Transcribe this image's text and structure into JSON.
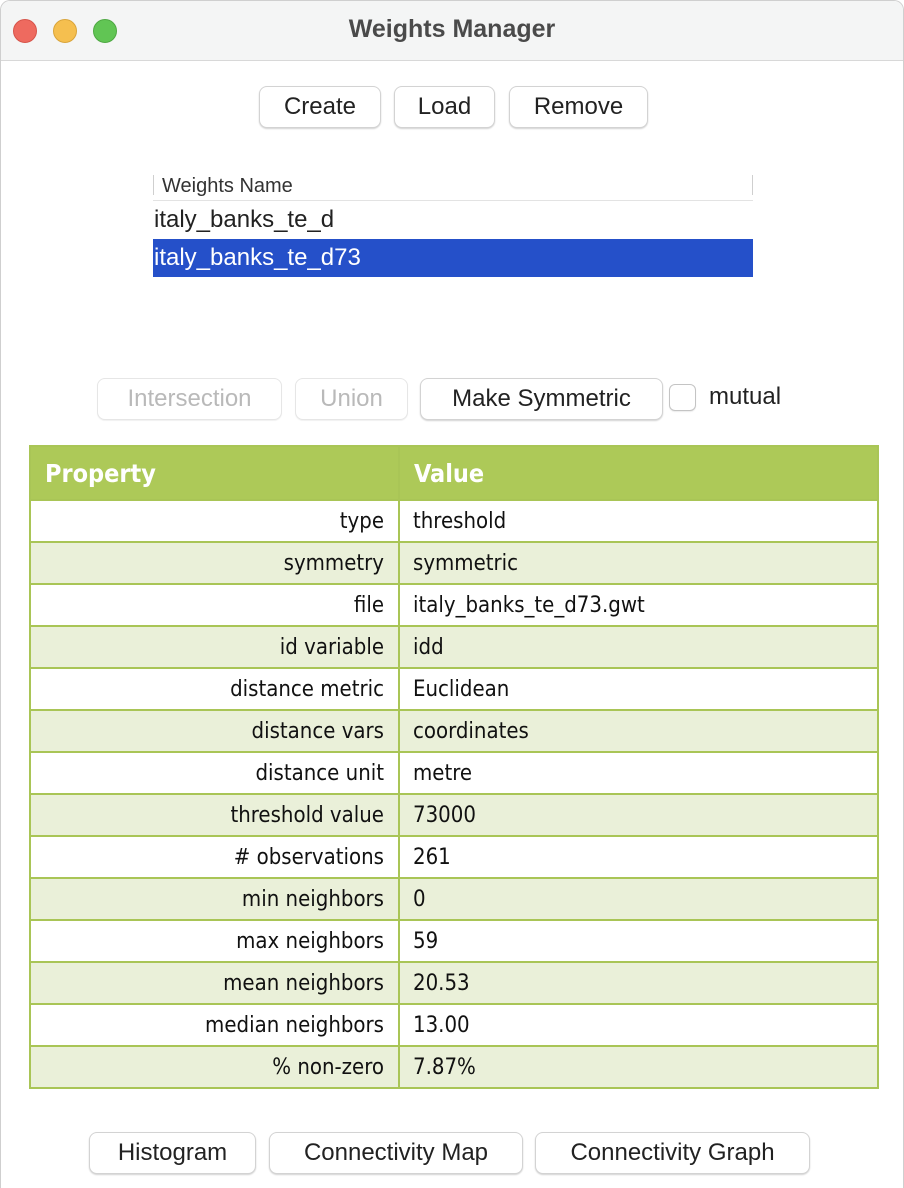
{
  "window": {
    "title": "Weights Manager"
  },
  "toolbar": {
    "create_label": "Create",
    "load_label": "Load",
    "remove_label": "Remove"
  },
  "weights_list": {
    "header": "Weights Name",
    "items": [
      {
        "name": "italy_banks_te_d",
        "selected": false
      },
      {
        "name": "italy_banks_te_d73",
        "selected": true
      }
    ]
  },
  "operations": {
    "intersection_label": "Intersection",
    "intersection_enabled": false,
    "union_label": "Union",
    "union_enabled": false,
    "make_symmetric_label": "Make Symmetric",
    "make_symmetric_enabled": true,
    "mutual_label": "mutual",
    "mutual_checked": false
  },
  "properties": {
    "header_property": "Property",
    "header_value": "Value",
    "rows": [
      {
        "property": "type",
        "value": "threshold"
      },
      {
        "property": "symmetry",
        "value": "symmetric"
      },
      {
        "property": "file",
        "value": "italy_banks_te_d73.gwt"
      },
      {
        "property": "id variable",
        "value": "idd"
      },
      {
        "property": "distance metric",
        "value": "Euclidean"
      },
      {
        "property": "distance vars",
        "value": "coordinates"
      },
      {
        "property": "distance unit",
        "value": "metre"
      },
      {
        "property": "threshold value",
        "value": "73000"
      },
      {
        "property": "# observations",
        "value": "261"
      },
      {
        "property": "min neighbors",
        "value": "0"
      },
      {
        "property": "max neighbors",
        "value": "59"
      },
      {
        "property": "mean neighbors",
        "value": "20.53"
      },
      {
        "property": "median neighbors",
        "value": "13.00"
      },
      {
        "property": "% non-zero",
        "value": "7.87%"
      }
    ]
  },
  "bottom_buttons": {
    "histogram_label": "Histogram",
    "connectivity_map_label": "Connectivity Map",
    "connectivity_graph_label": "Connectivity Graph"
  },
  "colors": {
    "selection": "#2550c9",
    "table_header": "#adc958",
    "table_border": "#a9c556",
    "table_stripe": "#eaf0d9"
  }
}
